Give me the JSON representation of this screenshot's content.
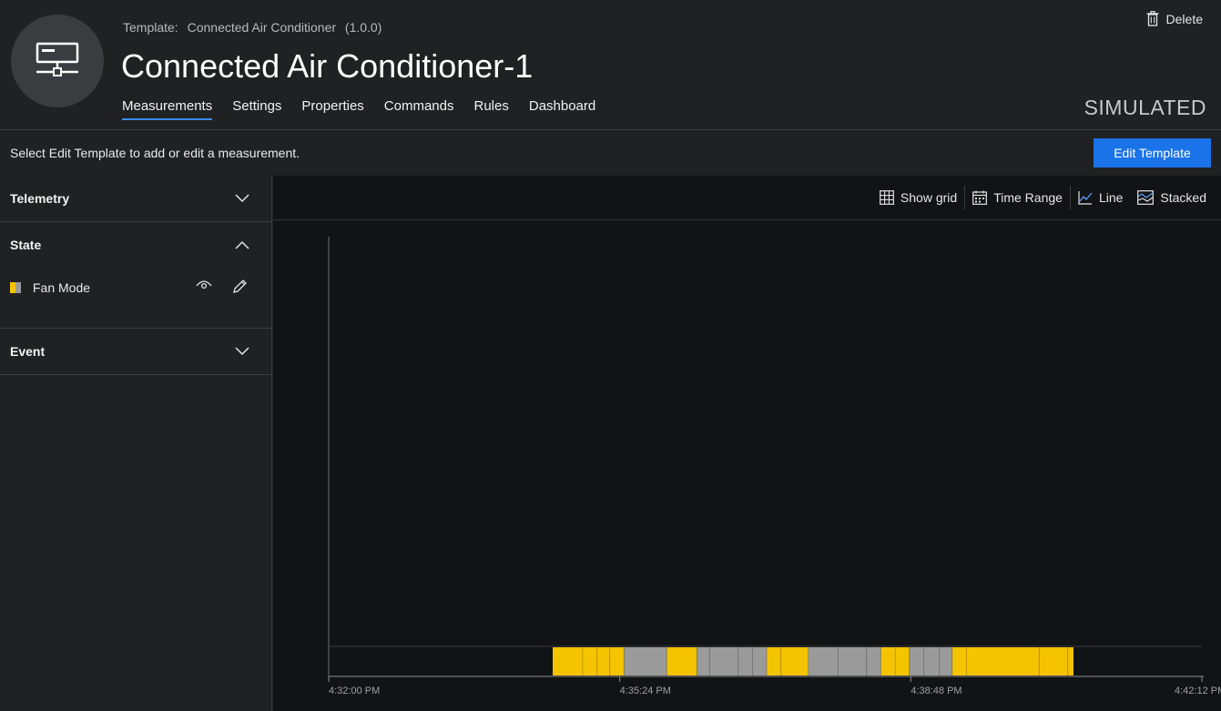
{
  "header": {
    "template_label": "Template:",
    "template_name": "Connected Air Conditioner",
    "template_version": "(1.0.0)",
    "device_name": "Connected Air Conditioner-1",
    "delete_label": "Delete",
    "status": "SIMULATED",
    "icon": "monitor-network-icon"
  },
  "tabs": [
    {
      "label": "Measurements",
      "active": true
    },
    {
      "label": "Settings"
    },
    {
      "label": "Properties"
    },
    {
      "label": "Commands"
    },
    {
      "label": "Rules"
    },
    {
      "label": "Dashboard"
    }
  ],
  "infobar": {
    "message": "Select Edit Template to add or edit a measurement.",
    "edit_button": "Edit Template"
  },
  "sidebar": {
    "sections": [
      {
        "title": "Telemetry",
        "expanded": false
      },
      {
        "title": "State",
        "expanded": true,
        "items": [
          {
            "label": "Fan Mode"
          }
        ]
      },
      {
        "title": "Event",
        "expanded": false
      }
    ]
  },
  "toolbar": {
    "show_grid": "Show grid",
    "time_range": "Time Range",
    "line": "Line",
    "stacked": "Stacked"
  },
  "colors": {
    "accent": "#1a73e8",
    "state_yellow": "#f5c400",
    "state_gray": "#9a9a9a"
  },
  "chart_data": {
    "type": "state-timeline",
    "series": [
      {
        "name": "Fan Mode"
      }
    ],
    "x_ticks": [
      "4:32:00 PM",
      "4:35:24 PM",
      "4:38:48 PM",
      "4:42:12 PM"
    ],
    "x_range_seconds": [
      0,
      612
    ],
    "segments": [
      {
        "start": 157,
        "end": 178,
        "state": "yellow"
      },
      {
        "start": 178,
        "end": 188,
        "state": "yellow"
      },
      {
        "start": 188,
        "end": 197,
        "state": "yellow"
      },
      {
        "start": 197,
        "end": 207,
        "state": "yellow"
      },
      {
        "start": 207,
        "end": 237,
        "state": "gray"
      },
      {
        "start": 237,
        "end": 258,
        "state": "yellow"
      },
      {
        "start": 258,
        "end": 267,
        "state": "gray"
      },
      {
        "start": 267,
        "end": 287,
        "state": "gray"
      },
      {
        "start": 287,
        "end": 297,
        "state": "gray"
      },
      {
        "start": 297,
        "end": 307,
        "state": "gray"
      },
      {
        "start": 307,
        "end": 317,
        "state": "yellow"
      },
      {
        "start": 317,
        "end": 336,
        "state": "yellow"
      },
      {
        "start": 336,
        "end": 357,
        "state": "gray"
      },
      {
        "start": 357,
        "end": 377,
        "state": "gray"
      },
      {
        "start": 377,
        "end": 387,
        "state": "gray"
      },
      {
        "start": 387,
        "end": 397,
        "state": "yellow"
      },
      {
        "start": 397,
        "end": 407,
        "state": "yellow"
      },
      {
        "start": 407,
        "end": 417,
        "state": "gray"
      },
      {
        "start": 417,
        "end": 428,
        "state": "gray"
      },
      {
        "start": 428,
        "end": 437,
        "state": "gray"
      },
      {
        "start": 437,
        "end": 447,
        "state": "yellow"
      },
      {
        "start": 447,
        "end": 498,
        "state": "yellow"
      },
      {
        "start": 498,
        "end": 518,
        "state": "yellow"
      },
      {
        "start": 518,
        "end": 522,
        "state": "yellow"
      }
    ]
  }
}
